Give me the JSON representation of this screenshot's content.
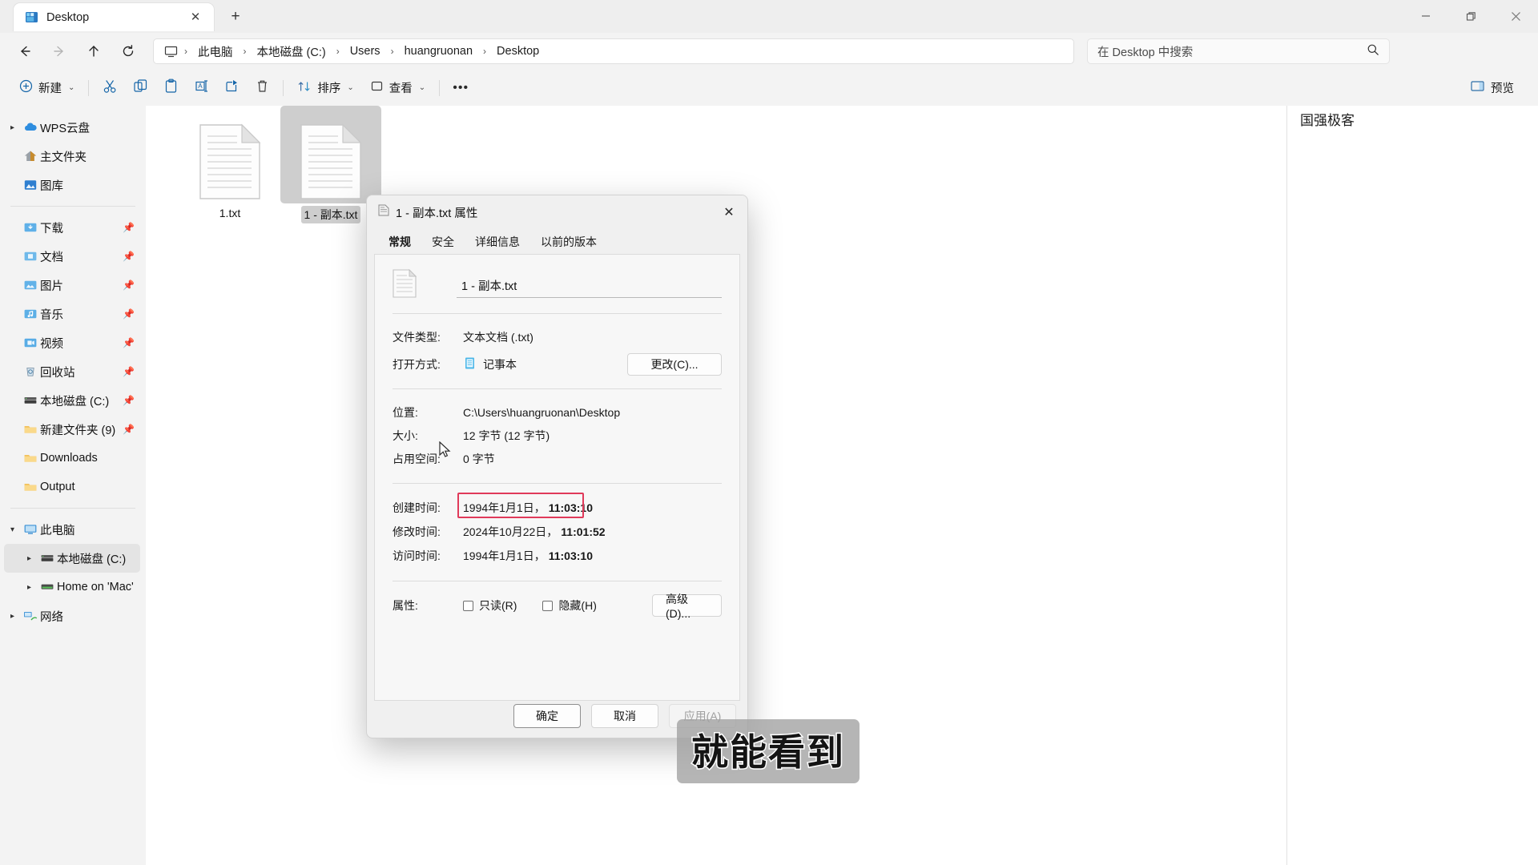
{
  "window": {
    "tab_label": "Desktop",
    "tab_icon": "folder-desktop-icon",
    "close_tab_glyph": "✕",
    "new_tab_glyph": "+",
    "minimize_name": "minimize-button",
    "maximize_name": "maximize-button",
    "close_name": "close-button"
  },
  "addressbar": {
    "back_name": "back-button",
    "forward_name": "forward-button",
    "up_name": "up-button",
    "refresh_name": "refresh-button",
    "breadcrumbs": [
      {
        "label": "此电脑"
      },
      {
        "label": "本地磁盘 (C:)"
      },
      {
        "label": "Users"
      },
      {
        "label": "huangruonan"
      },
      {
        "label": "Desktop"
      }
    ],
    "separator": "›",
    "search_placeholder": "在 Desktop 中搜索"
  },
  "commandbar": {
    "new_label": "新建",
    "cut_label": "剪切",
    "copy_label": "复制",
    "paste_label": "粘贴",
    "rename_label": "重命名",
    "share_label": "共享",
    "delete_label": "删除",
    "sort_label": "排序",
    "view_label": "查看",
    "more_label": "•••",
    "preview_label": "预览",
    "chevron": "⌄"
  },
  "sidebar": {
    "groups": [
      {
        "items": [
          {
            "label": "WPS云盘",
            "icon": "cloud-icon",
            "expandable": true,
            "pinned": false,
            "indent": 0,
            "selected": false
          },
          {
            "label": "主文件夹",
            "icon": "home-icon",
            "expandable": false,
            "pinned": false,
            "indent": 0,
            "selected": false
          },
          {
            "label": "图库",
            "icon": "gallery-icon",
            "expandable": false,
            "pinned": false,
            "indent": 0,
            "selected": false
          }
        ]
      },
      {
        "items": [
          {
            "label": "下载",
            "icon": "downloads-folder-icon",
            "expandable": false,
            "pinned": true,
            "indent": 0,
            "selected": false
          },
          {
            "label": "文档",
            "icon": "documents-folder-icon",
            "expandable": false,
            "pinned": true,
            "indent": 0,
            "selected": false
          },
          {
            "label": "图片",
            "icon": "pictures-folder-icon",
            "expandable": false,
            "pinned": true,
            "indent": 0,
            "selected": false
          },
          {
            "label": "音乐",
            "icon": "music-folder-icon",
            "expandable": false,
            "pinned": true,
            "indent": 0,
            "selected": false
          },
          {
            "label": "视频",
            "icon": "videos-folder-icon",
            "expandable": false,
            "pinned": true,
            "indent": 0,
            "selected": false
          },
          {
            "label": "回收站",
            "icon": "recycle-bin-icon",
            "expandable": false,
            "pinned": true,
            "indent": 0,
            "selected": false
          },
          {
            "label": "本地磁盘 (C:)",
            "icon": "drive-icon",
            "expandable": false,
            "pinned": true,
            "indent": 0,
            "selected": false
          },
          {
            "label": "新建文件夹 (9)",
            "icon": "folder-icon",
            "expandable": false,
            "pinned": true,
            "indent": 0,
            "selected": false
          },
          {
            "label": "Downloads",
            "icon": "folder-icon",
            "expandable": false,
            "pinned": false,
            "indent": 0,
            "selected": false
          },
          {
            "label": "Output",
            "icon": "folder-icon",
            "expandable": false,
            "pinned": false,
            "indent": 0,
            "selected": false
          }
        ]
      },
      {
        "items": [
          {
            "label": "此电脑",
            "icon": "this-pc-icon",
            "expandable": true,
            "expanded": true,
            "pinned": false,
            "indent": 0,
            "selected": false
          },
          {
            "label": "本地磁盘 (C:)",
            "icon": "drive-icon",
            "expandable": true,
            "pinned": false,
            "indent": 1,
            "selected": true
          },
          {
            "label": "Home on 'Mac' (",
            "icon": "network-drive-icon",
            "expandable": true,
            "pinned": false,
            "indent": 1,
            "selected": false
          },
          {
            "label": "网络",
            "icon": "network-icon",
            "expandable": true,
            "pinned": false,
            "indent": 0,
            "selected": false
          }
        ]
      }
    ]
  },
  "files": [
    {
      "name": "1.txt",
      "icon": "text-file-icon",
      "selected": false
    },
    {
      "name": "1 - 副本.txt",
      "icon": "text-file-icon",
      "selected": true
    }
  ],
  "right_pane": {
    "watermark": "国强极客"
  },
  "dialog": {
    "title": "1 - 副本.txt 属性",
    "close_glyph": "✕",
    "tabs": [
      {
        "label": "常规",
        "active": true
      },
      {
        "label": "安全",
        "active": false
      },
      {
        "label": "详细信息",
        "active": false
      },
      {
        "label": "以前的版本",
        "active": false
      }
    ],
    "filename_value": "1 - 副本.txt",
    "rows": [
      {
        "label": "文件类型:",
        "value": "文本文档 (.txt)"
      },
      {
        "label": "打开方式:",
        "value": "记事本",
        "button": "更改(C)...",
        "icon": "notepad-icon"
      },
      {
        "label": "位置:",
        "value": "C:\\Users\\huangruonan\\Desktop"
      },
      {
        "label": "大小:",
        "value": "12 字节 (12 字节)"
      },
      {
        "label": "占用空间:",
        "value": "0 字节"
      }
    ],
    "times": [
      {
        "label": "创建时间:",
        "date": "1994年1月1日，",
        "time": "11:03:10",
        "highlighted": true
      },
      {
        "label": "修改时间:",
        "date": "2024年10月22日，",
        "time": "11:01:52",
        "highlighted": false
      },
      {
        "label": "访问时间:",
        "date": "1994年1月1日，",
        "time": "11:03:10",
        "highlighted": false
      }
    ],
    "attributes": {
      "label": "属性:",
      "readonly_label": "只读(R)",
      "readonly_checked": false,
      "hidden_label": "隐藏(H)",
      "hidden_checked": false,
      "advanced_button": "高级(D)..."
    },
    "footer": {
      "ok": "确定",
      "cancel": "取消",
      "apply": "应用(A)",
      "apply_disabled": true
    },
    "highlight_color": "#e03a5a"
  },
  "subtitle": {
    "text": "就能看到"
  }
}
